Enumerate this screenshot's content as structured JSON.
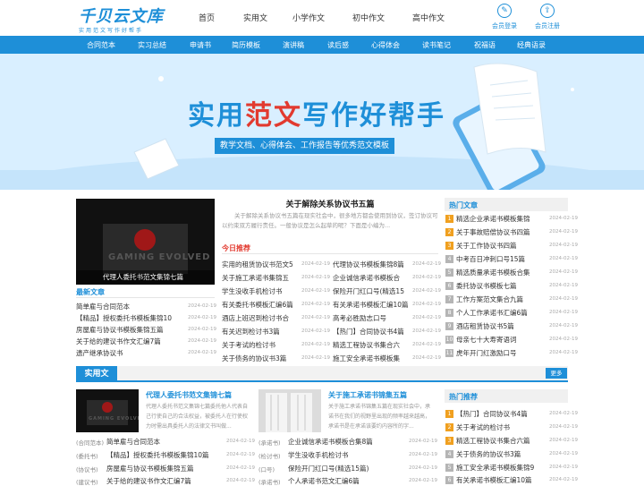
{
  "header": {
    "logo_main": "千贝云文库",
    "logo_sub": "实用范文写作好帮手",
    "nav": [
      "首页",
      "实用文",
      "小学作文",
      "初中作文",
      "高中作文"
    ],
    "login_label": "会员登录",
    "register_label": "会员注册"
  },
  "categories": [
    "合同范本",
    "实习总结",
    "申请书",
    "简历模板",
    "演讲稿",
    "读后感",
    "心得体会",
    "读书笔记",
    "祝福语",
    "经典语录"
  ],
  "banner": {
    "title_a": "实用",
    "title_b": "范文",
    "title_c": "写作好帮手",
    "subtitle": "教学文档、心得体会、工作报告等优秀范文模板"
  },
  "featured": {
    "image_caption": "代理人委托书范文集锦七篇",
    "image_text": "GAMING EVOLVED",
    "title": "关于解除关系协议书五篇",
    "summary": "关于解除关系协议书五篇在现实社会中，很多地方都会使用到协议，签订协议可以约束双方履行责任。一般协议是怎么起草的呢？下面是小编为..."
  },
  "latest": {
    "heading": "最新文章",
    "items": [
      {
        "title": "简单雇与合同范本",
        "date": "2024-02-19"
      },
      {
        "title": "【精品】授权委托书模板集锦10",
        "date": "2024-02-19"
      },
      {
        "title": "房屋雇与协议书模板集锦五篇",
        "date": "2024-02-19"
      },
      {
        "title": "关于给的建议书作文汇编7篇",
        "date": "2024-02-19"
      },
      {
        "title": "遗产继承协议书",
        "date": "2024-02-19"
      }
    ]
  },
  "today": {
    "heading": "今日推荐",
    "left": [
      {
        "title": "实用的租赁协议书范文5",
        "date": "2024-02-19"
      },
      {
        "title": "关于施工承诺书集锦五",
        "date": "2024-02-19"
      },
      {
        "title": "学生没收手机检讨书",
        "date": "2024-02-19"
      },
      {
        "title": "有关委托书模板汇编6篇",
        "date": "2024-02-19"
      },
      {
        "title": "酒店上班迟到检讨书合",
        "date": "2024-02-19"
      },
      {
        "title": "有关迟到检讨书3篇",
        "date": "2024-02-19"
      },
      {
        "title": "关于考试的检讨书",
        "date": "2024-02-19"
      },
      {
        "title": "关于债务的协议书3篇",
        "date": "2024-02-19"
      }
    ],
    "right": [
      {
        "title": "代理协议书模板集锦8篇",
        "date": "2024-02-19"
      },
      {
        "title": "企业诚信承诺书模板合",
        "date": "2024-02-19"
      },
      {
        "title": "保险开门红口号(精选15",
        "date": "2024-02-19"
      },
      {
        "title": "有关承诺书模板汇编10篇",
        "date": "2024-02-19"
      },
      {
        "title": "高考必胜励志口号",
        "date": "2024-02-19"
      },
      {
        "title": "【热门】合同协议书4篇",
        "date": "2024-02-19"
      },
      {
        "title": "精选工程协议书集合六",
        "date": "2024-02-19"
      },
      {
        "title": "施工安全承诺书模板集",
        "date": "2024-02-19"
      }
    ]
  },
  "hot_articles": {
    "heading": "热门文章",
    "items": [
      {
        "title": "精选企业承诺书模板集锦",
        "date": "2024-02-19"
      },
      {
        "title": "关于事故赔偿协议书四篇",
        "date": "2024-02-19"
      },
      {
        "title": "关于工作协议书四篇",
        "date": "2024-02-19"
      },
      {
        "title": "中考百日冲刺口号15篇",
        "date": "2024-02-19"
      },
      {
        "title": "精选质量承诺书模板合集",
        "date": "2024-02-19"
      },
      {
        "title": "委托协议书模板七篇",
        "date": "2024-02-19"
      },
      {
        "title": "工作方案范文集合九篇",
        "date": "2024-02-19"
      },
      {
        "title": "个人工作承诺书汇编6篇",
        "date": "2024-02-19"
      },
      {
        "title": "酒店租赁协议书5篇",
        "date": "2024-02-19"
      },
      {
        "title": "母亲七十大寿寄语词",
        "date": "2024-02-19"
      },
      {
        "title": "虎年开门红激励口号",
        "date": "2024-02-19"
      }
    ]
  },
  "practical": {
    "heading": "实用文",
    "more": "更多",
    "card1": {
      "title": "代理人委托书范文集锦七篇",
      "summary": "代理人委托书范文集锦七篇委托他人代表自己行使自己的合法权益，被委托人在行使权力时需出具委托人的法律文书叫做..."
    },
    "card2": {
      "title": "关于施工承诺书锦集五篇",
      "summary": "关于施工承诺书锦集五篇在现实社会中，承诺书在我们的视野里出现的频率越来越高，承诺书是在承诺该要约内容所的字..."
    },
    "list1": [
      {
        "tag": "(合同范本)",
        "title": "简单雇与合同范本",
        "date": "2024-02-19"
      },
      {
        "tag": "(委托书)",
        "title": "【精品】授权委托书模板集锦10篇",
        "date": "2024-02-19"
      },
      {
        "tag": "(协议书)",
        "title": "房屋雇与协议书模板集锦五篇",
        "date": "2024-02-19"
      },
      {
        "tag": "(建议书)",
        "title": "关于给的建议书作文汇编7篇",
        "date": "2024-02-19"
      }
    ],
    "list2": [
      {
        "tag": "(承诺书)",
        "title": "企业诚信承诺书模板合集8篇",
        "date": "2024-02-19"
      },
      {
        "tag": "(检讨书)",
        "title": "学生没收手机检讨书",
        "date": "2024-02-19"
      },
      {
        "tag": "(口号)",
        "title": "保险开门红口号(精选15篇)",
        "date": "2024-02-19"
      },
      {
        "tag": "(承诺书)",
        "title": "个人承诺书范文汇编6篇",
        "date": "2024-02-19"
      }
    ]
  },
  "hot_recommend": {
    "heading": "热门推荐",
    "items": [
      {
        "title": "【热门】合同协议书4篇",
        "date": "2024-02-19"
      },
      {
        "title": "关于考试的检讨书",
        "date": "2024-02-19"
      },
      {
        "title": "精选工程协议书集合六篇",
        "date": "2024-02-19"
      },
      {
        "title": "关于债务的协议书3篇",
        "date": "2024-02-19"
      },
      {
        "title": "施工安全承诺书模板集锦9",
        "date": "2024-02-19"
      },
      {
        "title": "有关承诺书模板汇编10篇",
        "date": "2024-02-19"
      }
    ]
  },
  "colors": {
    "brand": "#1e8fd8",
    "accent_red": "#e23a2f",
    "rank_top": "#f0a020",
    "rank_rest": "#b5b5b5"
  }
}
